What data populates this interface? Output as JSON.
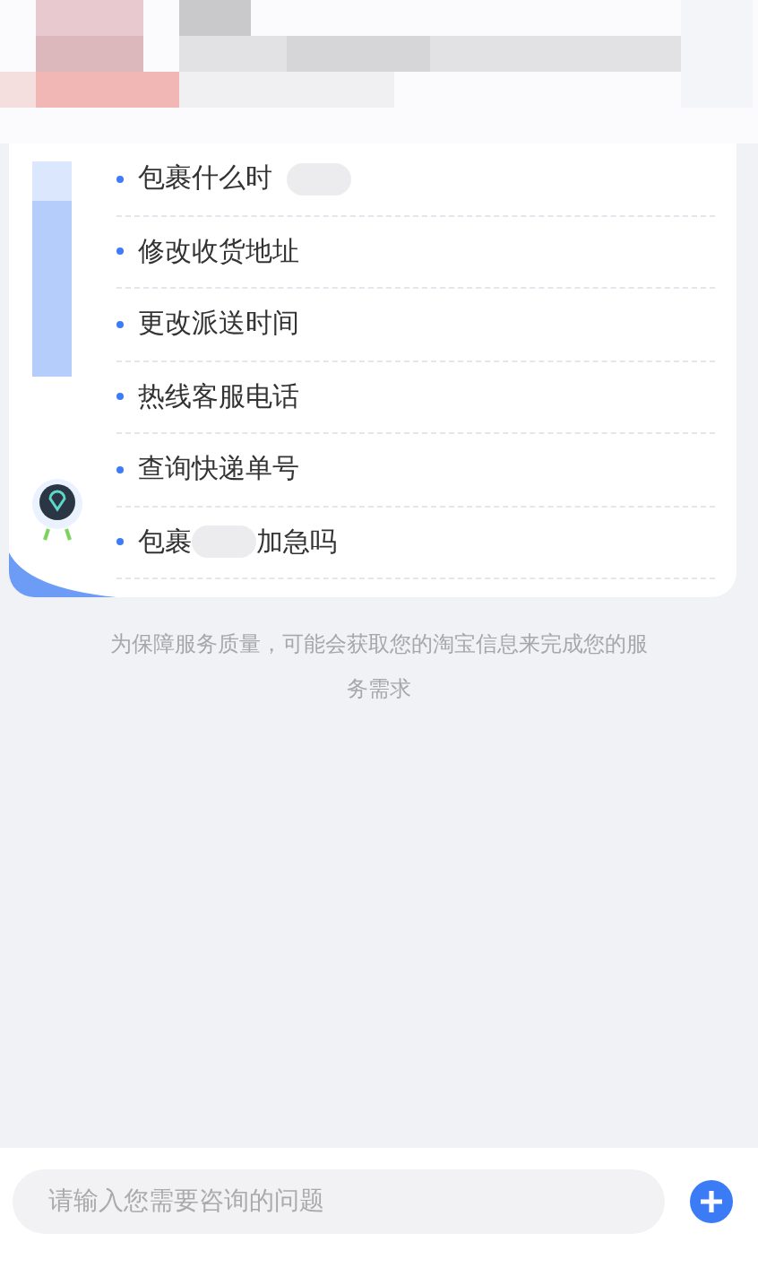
{
  "quick_questions": [
    {
      "text": "包裹什么时",
      "redacted": true
    },
    {
      "text": "修改收货地址"
    },
    {
      "text": "更改派送时间"
    },
    {
      "text": "热线客服电话"
    },
    {
      "text": "查询快递单号"
    },
    {
      "text": "包裹",
      "redacted": true,
      "text_after": "加急吗"
    }
  ],
  "notice": "为保障服务质量，可能会获取您的淘宝信息来完成您的服务需求",
  "input": {
    "placeholder": "请输入您需要咨询的问题"
  }
}
